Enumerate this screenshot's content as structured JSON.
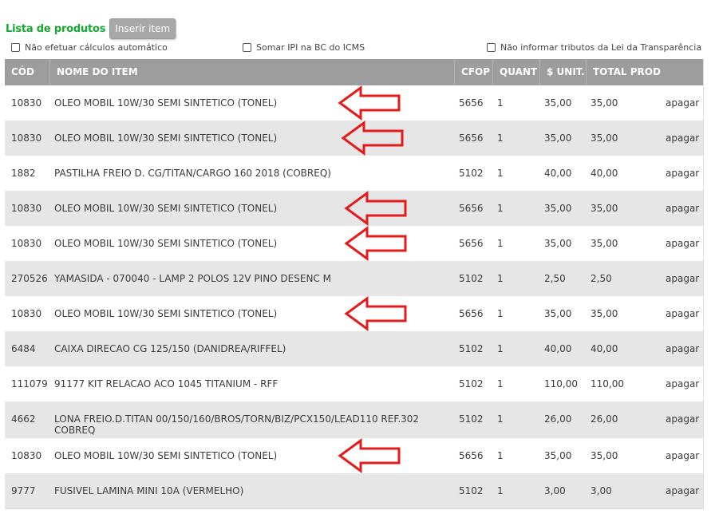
{
  "header": {
    "title": "Lista de produtos",
    "insert_button": "Inserir item"
  },
  "options": [
    {
      "label": "Não efetuar cálculos automático",
      "checked": false
    },
    {
      "label": "Somar IPI na BC do ICMS",
      "checked": false
    },
    {
      "label": "Não informar tributos da Lei da Transparência",
      "checked": false
    }
  ],
  "table": {
    "columns": [
      "CÓD",
      "NOME DO ITEM",
      "CFOP",
      "QUANT",
      "$ UNIT.",
      "TOTAL PROD"
    ],
    "rows": [
      {
        "cod": "10830",
        "nome": "OLEO MOBIL 10W/30 SEMI SINTETICO (TONEL)",
        "cfop": "5656",
        "quant": "1",
        "unit": "35,00",
        "total": "35,00",
        "action": "apagar",
        "marked": true
      },
      {
        "cod": "10830",
        "nome": "OLEO MOBIL 10W/30 SEMI SINTETICO (TONEL)",
        "cfop": "5656",
        "quant": "1",
        "unit": "35,00",
        "total": "35,00",
        "action": "apagar",
        "marked": true
      },
      {
        "cod": "1882",
        "nome": "PASTILHA FREIO D. CG/TITAN/CARGO 160 2018 (COBREQ)",
        "cfop": "5102",
        "quant": "1",
        "unit": "40,00",
        "total": "40,00",
        "action": "apagar",
        "marked": false
      },
      {
        "cod": "10830",
        "nome": "OLEO MOBIL 10W/30 SEMI SINTETICO (TONEL)",
        "cfop": "5656",
        "quant": "1",
        "unit": "35,00",
        "total": "35,00",
        "action": "apagar",
        "marked": true
      },
      {
        "cod": "10830",
        "nome": "OLEO MOBIL 10W/30 SEMI SINTETICO (TONEL)",
        "cfop": "5656",
        "quant": "1",
        "unit": "35,00",
        "total": "35,00",
        "action": "apagar",
        "marked": true
      },
      {
        "cod": "270526",
        "nome": "YAMASIDA - 070040 - LAMP 2 POLOS 12V PINO DESENC M",
        "cfop": "5102",
        "quant": "1",
        "unit": "2,50",
        "total": "2,50",
        "action": "apagar",
        "marked": false
      },
      {
        "cod": "10830",
        "nome": "OLEO MOBIL 10W/30 SEMI SINTETICO (TONEL)",
        "cfop": "5656",
        "quant": "1",
        "unit": "35,00",
        "total": "35,00",
        "action": "apagar",
        "marked": true
      },
      {
        "cod": "6484",
        "nome": "CAIXA DIRECAO CG 125/150 (DANIDREA/RIFFEL)",
        "cfop": "5102",
        "quant": "1",
        "unit": "40,00",
        "total": "40,00",
        "action": "apagar",
        "marked": false
      },
      {
        "cod": "111079",
        "nome": "91177 KIT RELACAO ACO 1045 TITANIUM - RFF",
        "cfop": "5102",
        "quant": "1",
        "unit": "110,00",
        "total": "110,00",
        "action": "apagar",
        "marked": false
      },
      {
        "cod": "4662",
        "nome": "LONA FREIO.D.TITAN 00/150/160/BROS/TORN/BIZ/PCX150/LEAD110 REF.302 COBREQ",
        "cfop": "5102",
        "quant": "1",
        "unit": "26,00",
        "total": "26,00",
        "action": "apagar",
        "marked": false
      },
      {
        "cod": "10830",
        "nome": "OLEO MOBIL 10W/30 SEMI SINTETICO (TONEL)",
        "cfop": "5656",
        "quant": "1",
        "unit": "35,00",
        "total": "35,00",
        "action": "apagar",
        "marked": true
      },
      {
        "cod": "9777",
        "nome": "FUSIVEL LAMINA MINI 10A (VERMELHO)",
        "cfop": "5102",
        "quant": "1",
        "unit": "3,00",
        "total": "3,00",
        "action": "apagar",
        "marked": false
      }
    ]
  },
  "colors": {
    "title_green": "#17a832",
    "header_gray": "#9d9d9d",
    "row_alt": "#e6e6e6",
    "arrow_red": "#e41b1b"
  }
}
